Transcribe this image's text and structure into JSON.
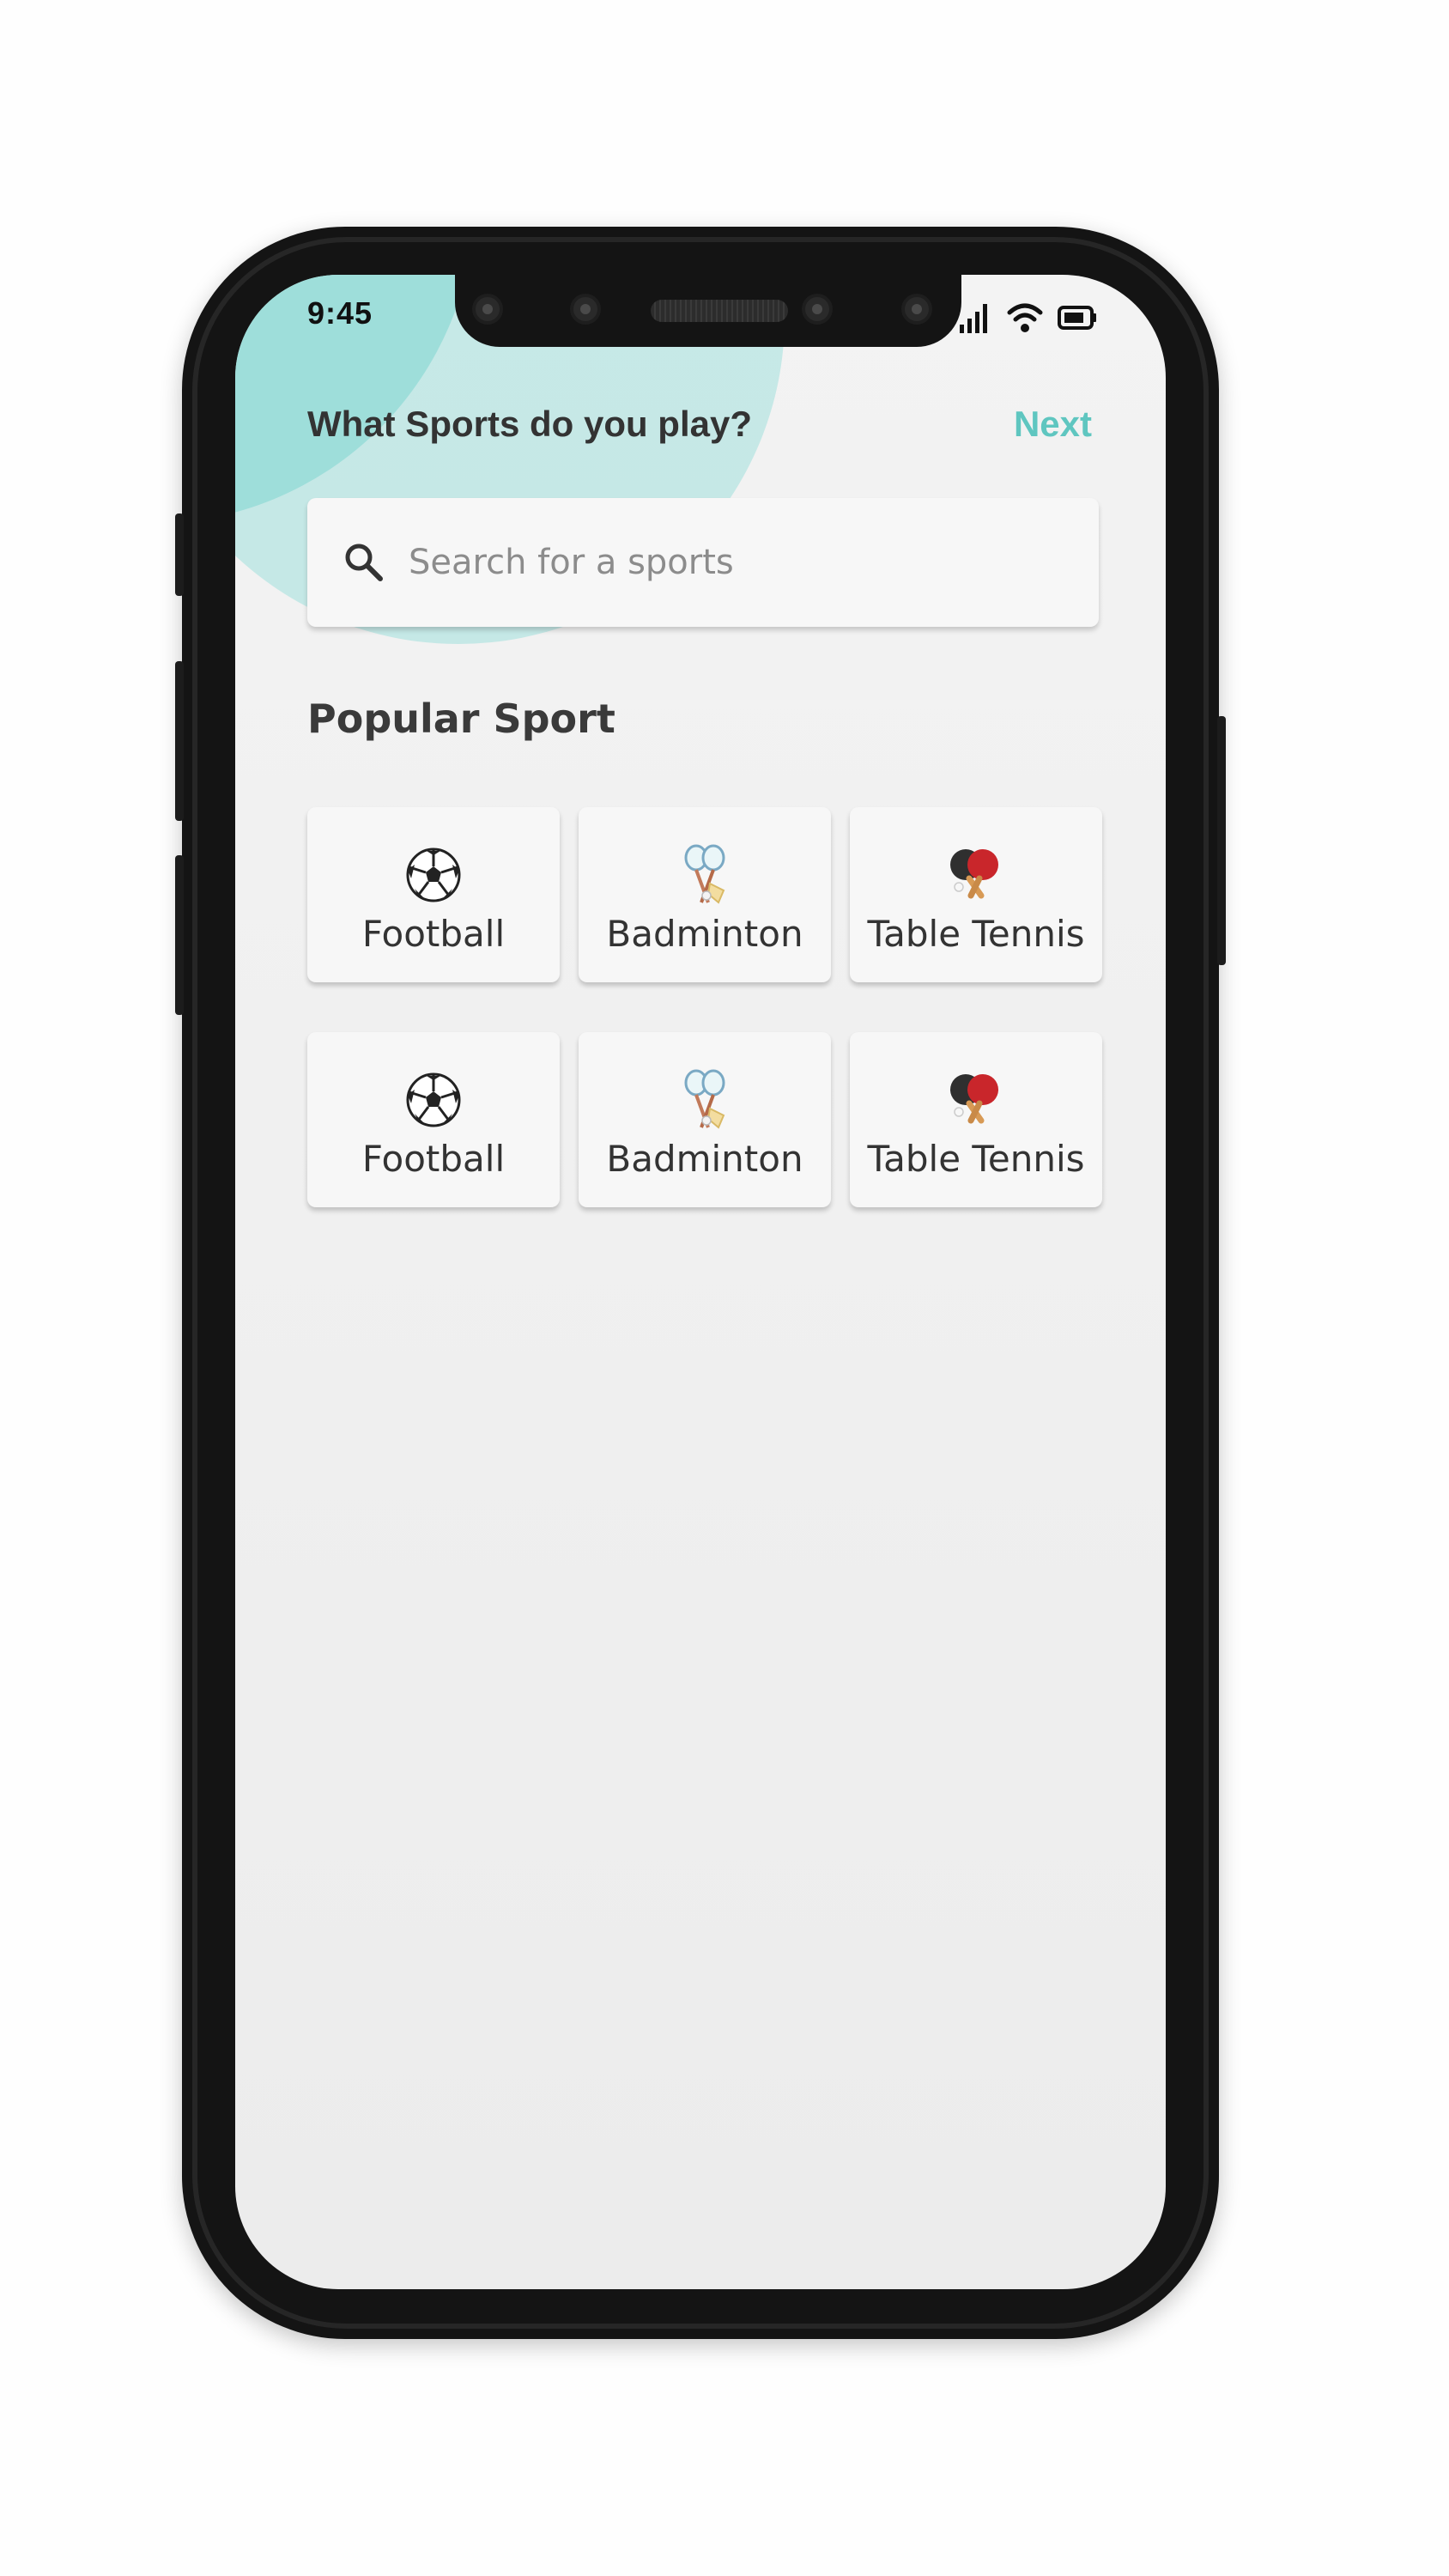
{
  "status_bar": {
    "time": "9:45"
  },
  "header": {
    "title": "What Sports do you play?",
    "next_label": "Next"
  },
  "search": {
    "placeholder": "Search for a sports",
    "value": ""
  },
  "popular": {
    "title": "Popular Sport",
    "items": [
      {
        "label": "Football",
        "icon": "soccer-ball-icon"
      },
      {
        "label": "Badminton",
        "icon": "badminton-icon"
      },
      {
        "label": "Table Tennis",
        "icon": "table-tennis-icon"
      },
      {
        "label": "Football",
        "icon": "soccer-ball-icon"
      },
      {
        "label": "Badminton",
        "icon": "badminton-icon"
      },
      {
        "label": "Table Tennis",
        "icon": "table-tennis-icon"
      }
    ]
  },
  "colors": {
    "accent": "#5fc6c0",
    "blob": "#7dd5cf",
    "text": "#333333"
  }
}
